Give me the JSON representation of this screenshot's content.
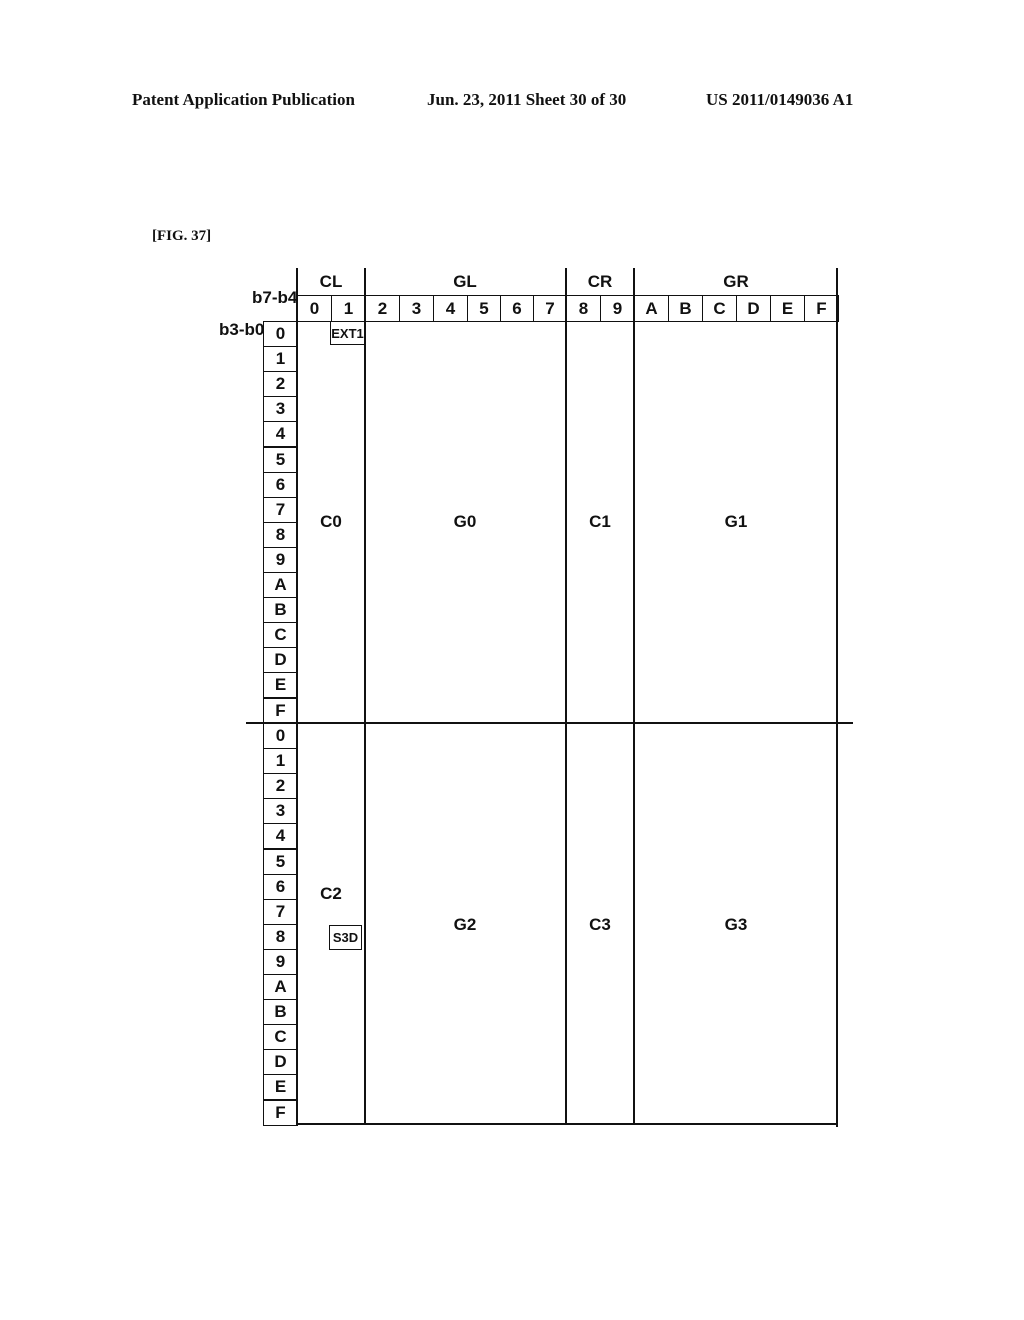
{
  "header": {
    "publication": "Patent Application Publication",
    "date_sheet": "Jun. 23, 2011  Sheet 30 of 30",
    "number": "US 2011/0149036 A1"
  },
  "figure": {
    "label": "[FIG. 37]",
    "column_axis_label": "b7-b4",
    "row_axis_label": "b3-b0",
    "column_groups": [
      {
        "name": "CL",
        "columns": [
          "0",
          "1"
        ]
      },
      {
        "name": "GL",
        "columns": [
          "2",
          "3",
          "4",
          "5",
          "6",
          "7"
        ]
      },
      {
        "name": "CR",
        "columns": [
          "8",
          "9"
        ]
      },
      {
        "name": "GR",
        "columns": [
          "A",
          "B",
          "C",
          "D",
          "E",
          "F"
        ]
      }
    ],
    "columns": [
      "0",
      "1",
      "2",
      "3",
      "4",
      "5",
      "6",
      "7",
      "8",
      "9",
      "A",
      "B",
      "C",
      "D",
      "E",
      "F"
    ],
    "rows_upper": [
      "0",
      "1",
      "2",
      "3",
      "4",
      "5",
      "6",
      "7",
      "8",
      "9",
      "A",
      "B",
      "C",
      "D",
      "E",
      "F"
    ],
    "rows_lower": [
      "0",
      "1",
      "2",
      "3",
      "4",
      "5",
      "6",
      "7",
      "8",
      "9",
      "A",
      "B",
      "C",
      "D",
      "E",
      "F"
    ],
    "regions_upper": [
      "C0",
      "G0",
      "C1",
      "G1"
    ],
    "regions_lower": [
      "C2",
      "G2",
      "C3",
      "G3"
    ],
    "tags": {
      "ext1": "EXT1",
      "s3d": "S3D"
    }
  }
}
